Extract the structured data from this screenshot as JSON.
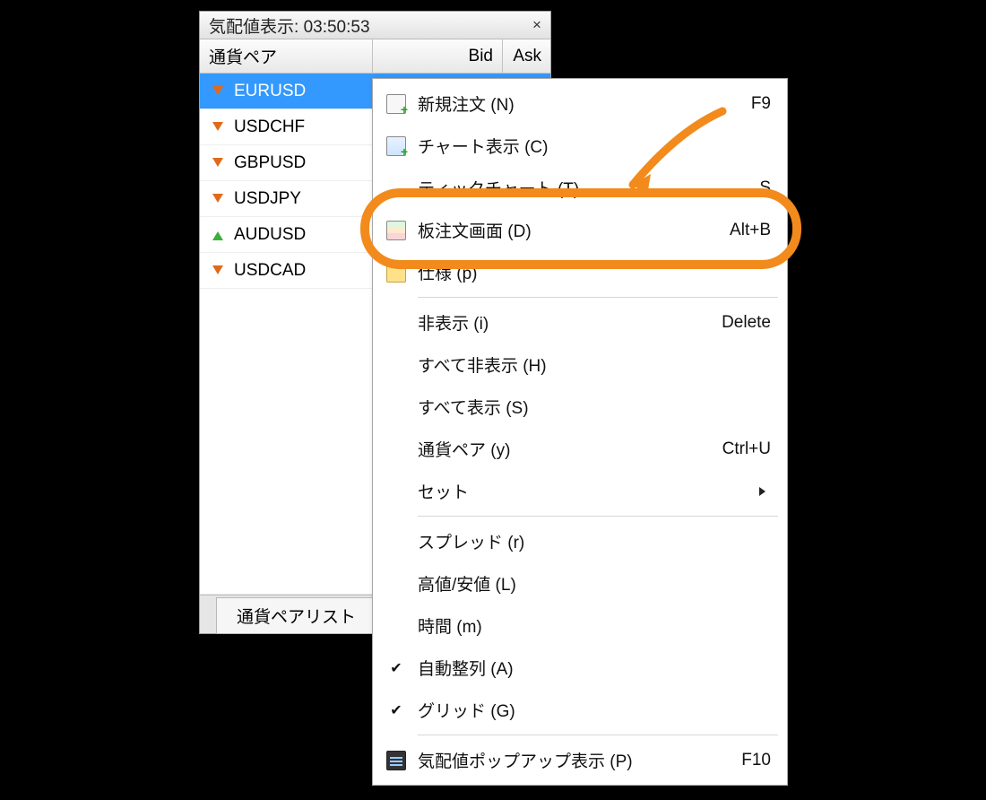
{
  "window": {
    "title_prefix": "気配値表示: ",
    "time": "03:50:53",
    "close_glyph": "×"
  },
  "columns": {
    "pair": "通貨ペア",
    "bid": "Bid",
    "ask": "Ask"
  },
  "pairs": [
    {
      "symbol": "EURUSD",
      "direction": "down",
      "selected": true
    },
    {
      "symbol": "USDCHF",
      "direction": "down",
      "selected": false
    },
    {
      "symbol": "GBPUSD",
      "direction": "down",
      "selected": false
    },
    {
      "symbol": "USDJPY",
      "direction": "down",
      "selected": false
    },
    {
      "symbol": "AUDUSD",
      "direction": "up",
      "selected": false
    },
    {
      "symbol": "USDCAD",
      "direction": "down",
      "selected": false
    }
  ],
  "tab": {
    "label": "通貨ペアリスト"
  },
  "menu": {
    "items": [
      {
        "icon": "new",
        "label": "新規注文 (N)",
        "hotkey": "F9"
      },
      {
        "icon": "chart",
        "label": "チャート表示 (C)",
        "hotkey": ""
      },
      {
        "icon": "",
        "label": "ティックチャート (T)",
        "hotkey": "S",
        "partially_hidden": true
      },
      {
        "icon": "dom",
        "label": "板注文画面 (D)",
        "hotkey": "Alt+B",
        "highlighted": true
      },
      {
        "icon": "spec",
        "label": "仕様 (p)",
        "hotkey": "",
        "partially_hidden": true
      },
      {
        "separator": true
      },
      {
        "icon": "",
        "label": "非表示 (i)",
        "hotkey": "Delete"
      },
      {
        "icon": "",
        "label": "すべて非表示 (H)",
        "hotkey": ""
      },
      {
        "icon": "",
        "label": "すべて表示 (S)",
        "hotkey": ""
      },
      {
        "icon": "",
        "label": "通貨ペア (y)",
        "hotkey": "Ctrl+U"
      },
      {
        "icon": "",
        "label": "セット",
        "hotkey": "",
        "submenu": true
      },
      {
        "separator": true
      },
      {
        "icon": "",
        "label": "スプレッド (r)",
        "hotkey": ""
      },
      {
        "icon": "",
        "label": "高値/安値 (L)",
        "hotkey": ""
      },
      {
        "icon": "",
        "label": "時間 (m)",
        "hotkey": ""
      },
      {
        "icon": "check",
        "label": "自動整列 (A)",
        "hotkey": ""
      },
      {
        "icon": "check",
        "label": "グリッド (G)",
        "hotkey": ""
      },
      {
        "separator": true
      },
      {
        "icon": "popup",
        "label": "気配値ポップアップ表示 (P)",
        "hotkey": "F10"
      }
    ]
  }
}
